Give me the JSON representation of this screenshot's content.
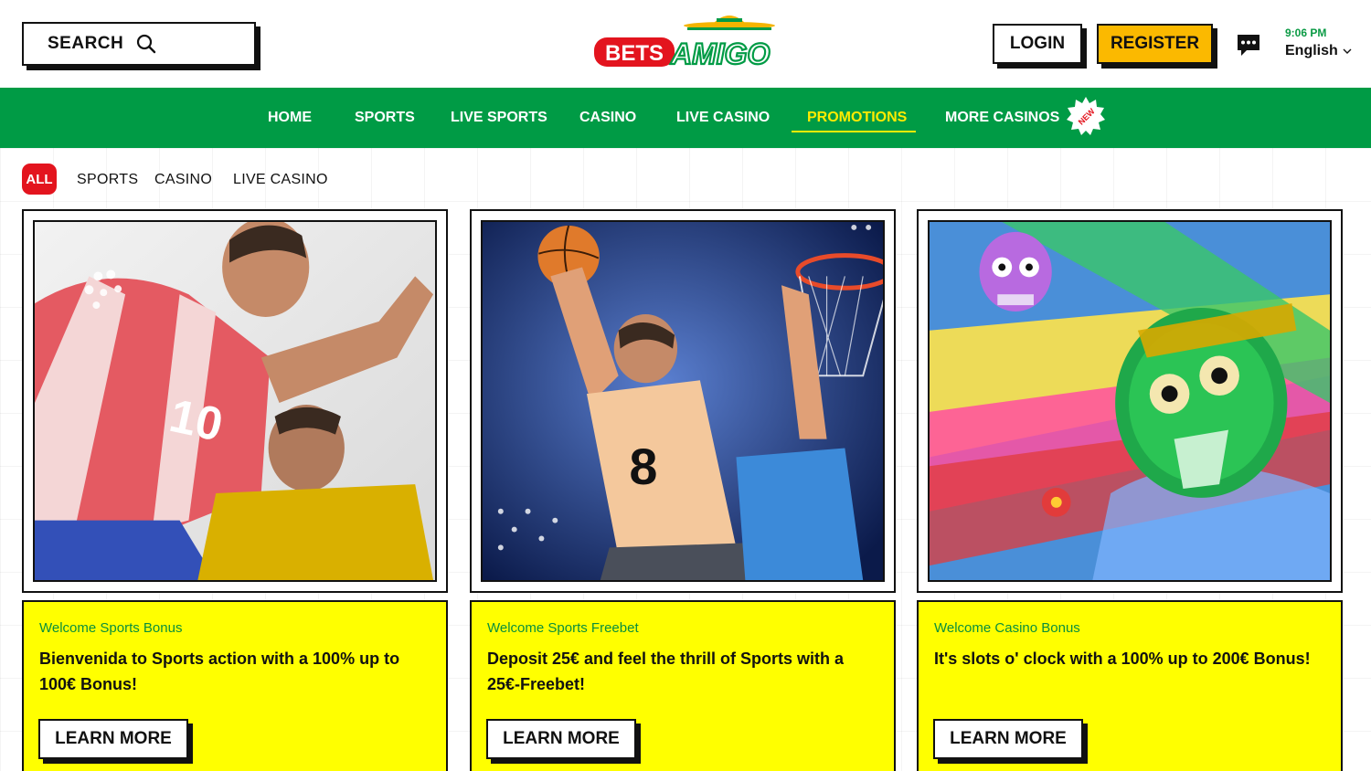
{
  "header": {
    "search_label": "SEARCH",
    "logo_text_left": "BETS",
    "logo_text_right": "AMIGO",
    "login_label": "LOGIN",
    "register_label": "REGISTER",
    "time": "9:06 PM",
    "language": "English"
  },
  "nav": {
    "items": [
      {
        "label": "HOME"
      },
      {
        "label": "SPORTS"
      },
      {
        "label": "LIVE SPORTS"
      },
      {
        "label": "CASINO"
      },
      {
        "label": "LIVE CASINO"
      },
      {
        "label": "PROMOTIONS",
        "active": true
      },
      {
        "label": "MORE CASINOS"
      }
    ],
    "new_badge": "NEW"
  },
  "filters": {
    "items": [
      {
        "label": "ALL",
        "active": true
      },
      {
        "label": "SPORTS"
      },
      {
        "label": "CASINO"
      },
      {
        "label": "LIVE CASINO"
      }
    ]
  },
  "cards": [
    {
      "tag": "Welcome Sports Bonus",
      "title": "Bienvenida to Sports action with a 100% up to 100€ Bonus!",
      "button": "LEARN MORE",
      "jersey_number": "10"
    },
    {
      "tag": "Welcome Sports Freebet",
      "title": "Deposit 25€ and feel the thrill of Sports with a 25€-Freebet!",
      "button": "LEARN MORE",
      "jersey_number": "8"
    },
    {
      "tag": "Welcome Casino Bonus",
      "title": "It's slots o' clock with a 100% up to 200€ Bonus!",
      "button": "LEARN MORE"
    }
  ],
  "colors": {
    "brand_green": "#009b45",
    "accent_yellow": "#ffeb00",
    "register_orange": "#fbb900",
    "logo_red": "#e3141e",
    "card_yellow": "#ffff00"
  }
}
